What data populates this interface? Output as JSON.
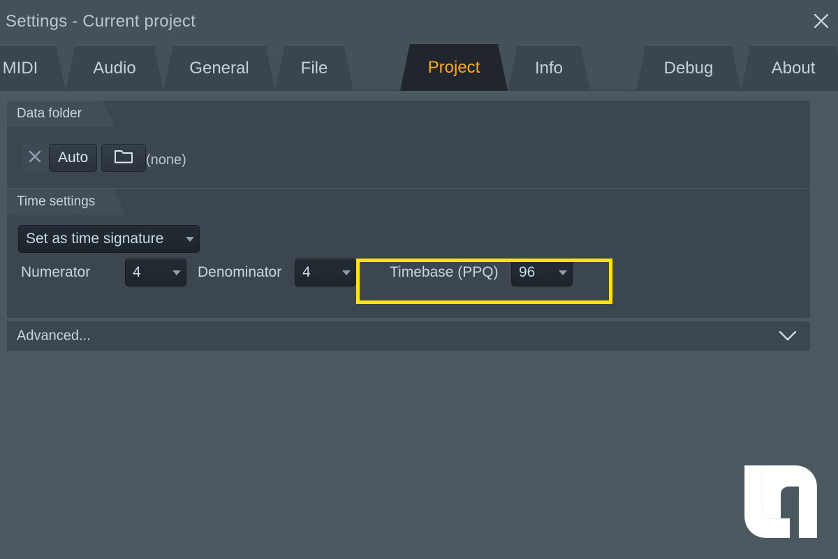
{
  "window": {
    "title": "Settings - Current project",
    "close_icon": "close-icon"
  },
  "tabs": [
    {
      "label": "MIDI",
      "active": false
    },
    {
      "label": "Audio",
      "active": false
    },
    {
      "label": "General",
      "active": false
    },
    {
      "label": "File",
      "active": false
    },
    {
      "label": "Project",
      "active": true
    },
    {
      "label": "Info",
      "active": false
    },
    {
      "label": "Debug",
      "active": false
    },
    {
      "label": "About",
      "active": false
    }
  ],
  "data_folder": {
    "header": "Data folder",
    "clear_icon": "close-x-icon",
    "auto_label": "Auto",
    "browse_icon": "folder-icon",
    "path_value": "(none)"
  },
  "time_settings": {
    "header": "Time settings",
    "mode_dropdown": {
      "value": "Set as time signature",
      "caret_icon": "chevron-down-icon"
    },
    "numerator": {
      "label": "Numerator",
      "value": "4",
      "caret_icon": "chevron-down-icon"
    },
    "denominator": {
      "label": "Denominator",
      "value": "4",
      "caret_icon": "chevron-down-icon"
    },
    "timebase": {
      "label": "Timebase (PPQ)",
      "value": "96",
      "caret_icon": "chevron-down-icon",
      "highlighted": true
    }
  },
  "advanced": {
    "label": "Advanced...",
    "chevron_icon": "chevron-down-icon"
  },
  "colors": {
    "background": "#4b5860",
    "panel": "#3b464e",
    "titlebar": "#455159",
    "tab_inactive": "#3a454d",
    "tab_active_bg": "#20262c",
    "tab_active_text": "#ffaa11",
    "dropdown_bg": "#222b33",
    "text": "#c8d5de",
    "highlight": "#ffe400"
  },
  "watermark": {
    "name": "brand-logo"
  }
}
